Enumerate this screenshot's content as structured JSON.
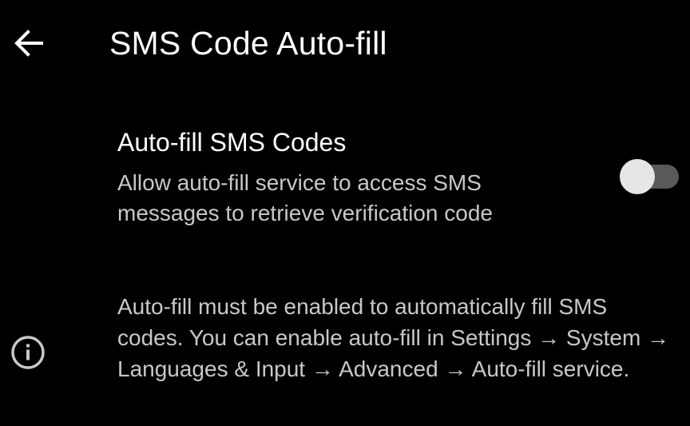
{
  "header": {
    "back_icon": "arrow-left-icon",
    "title": "SMS Code Auto-fill"
  },
  "setting": {
    "title": "Auto-fill SMS Codes",
    "summary": "Allow auto-fill service to access SMS messages to retrieve verification code",
    "toggle_state": "off"
  },
  "info": {
    "icon": "info-icon",
    "text": "Auto-fill must be enabled to automatically fill SMS codes. You can enable auto-fill in Settings → System → Languages & Input → Advanced → Auto-fill service."
  },
  "colors": {
    "background": "#000000",
    "primary_text": "#ffffff",
    "secondary_text": "#c8c8c8",
    "toggle_track": "#595959",
    "toggle_thumb": "#e6e6e6"
  }
}
